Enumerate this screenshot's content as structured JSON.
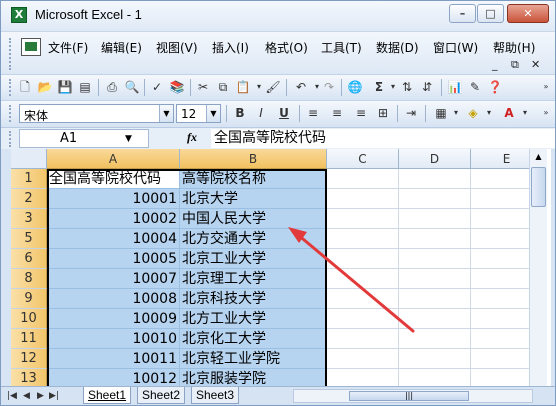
{
  "window": {
    "title": "Microsoft Excel - 1",
    "icon": "excel-app-icon"
  },
  "menubar": {
    "items": [
      "文件(F)",
      "编辑(E)",
      "视图(V)",
      "插入(I)",
      "格式(O)",
      "工具(T)",
      "数据(D)",
      "窗口(W)",
      "帮助(H)"
    ]
  },
  "formatting": {
    "font": "宋体",
    "size": "12",
    "bold": "B",
    "italic": "I",
    "underline": "U"
  },
  "formula_bar": {
    "name_box": "A1",
    "fx": "fx",
    "content": "全国高等院校代码"
  },
  "grid": {
    "columns": [
      "A",
      "B",
      "C",
      "D",
      "E"
    ],
    "rows": [
      {
        "row": "1",
        "a": "全国高等院校代码",
        "b": "高等院校名称"
      },
      {
        "row": "2",
        "a": "10001",
        "b": "北京大学"
      },
      {
        "row": "3",
        "a": "10002",
        "b": "中国人民大学"
      },
      {
        "row": "5",
        "a": "10004",
        "b": "北方交通大学"
      },
      {
        "row": "6",
        "a": "10005",
        "b": "北京工业大学"
      },
      {
        "row": "8",
        "a": "10007",
        "b": "北京理工大学"
      },
      {
        "row": "9",
        "a": "10008",
        "b": "北京科技大学"
      },
      {
        "row": "10",
        "a": "10009",
        "b": "北方工业大学"
      },
      {
        "row": "11",
        "a": "10010",
        "b": "北京化工大学"
      },
      {
        "row": "12",
        "a": "10011",
        "b": "北京轻工业学院"
      },
      {
        "row": "13",
        "a": "10012",
        "b": "北京服装学院"
      }
    ]
  },
  "sheets": [
    "Sheet1",
    "Sheet2",
    "Sheet3"
  ],
  "colors": {
    "selection": "#b6d3ef",
    "header_selected": "#f1c15f",
    "arrow": "#e03030"
  }
}
